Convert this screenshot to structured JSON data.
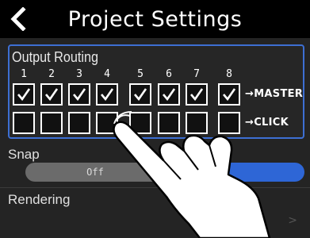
{
  "header": {
    "title": "Project Settings",
    "back_icon": "chevron-left-icon"
  },
  "output_routing": {
    "label": "Output Routing",
    "channels": [
      "1",
      "2",
      "3",
      "4",
      "5",
      "6",
      "7",
      "8"
    ],
    "master": {
      "label": "→MASTER",
      "checked": [
        true,
        true,
        true,
        true,
        true,
        true,
        true,
        true
      ]
    },
    "click": {
      "label": "→CLICK",
      "checked": [
        false,
        false,
        false,
        false,
        false,
        false,
        false,
        false
      ]
    }
  },
  "snap": {
    "label": "Snap",
    "off_label": "Off",
    "selected": "On"
  },
  "rendering": {
    "label": "Rendering",
    "chevron_icon": "chevron-right-icon"
  },
  "colors": {
    "accent": "#2e66d6",
    "focus_border": "#3d6fd3",
    "background": "#242424"
  },
  "overlay": {
    "icon": "tapping-hand-icon"
  }
}
